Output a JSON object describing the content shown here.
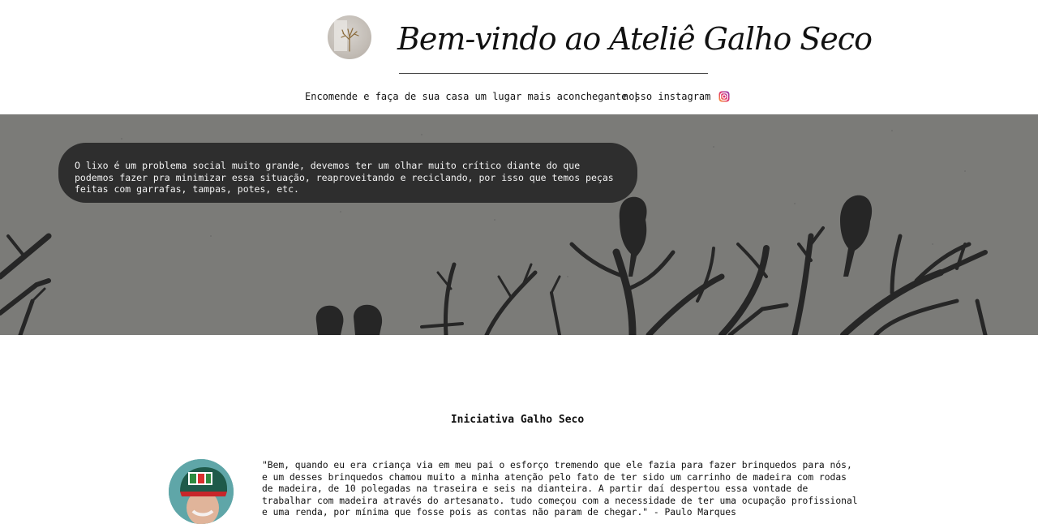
{
  "header": {
    "logo_icon": "branch-logo-icon",
    "title": "Bem-vindo ao Ateliê Galho Seco",
    "tagline": "Encomende e faça de sua casa um lugar mais aconchegante |",
    "instagram_link": "nosso instagram",
    "instagram_icon": "instagram-icon"
  },
  "hero": {
    "bubble_text": "O lixo é um problema social muito grande, devemos ter um olhar muito crítico diante do que podemos fazer pra minimizar essa situação, reaproveitando e reciclando, por isso que temos peças feitas com garrafas, tampas, potes, etc.",
    "background_color": "#7b7b78"
  },
  "initiative": {
    "title": "Iniciativa Galho Seco",
    "quote": "\"Bem, quando eu era criança via em meu pai o esforço tremendo que ele fazia para fazer brinquedos para nós, e um desses brinquedos chamou muito a minha atenção pelo fato de ter sido um carrinho de madeira com rodas de madeira, de 10 polegadas na traseira e seis na dianteira. A partir daí despertou essa vontade de trabalhar com madeira através do artesanato. tudo começou com a necessidade de ter uma ocupação profissional e uma renda, por mínima que fosse pois as contas não param de chegar.\" - Paulo Marques"
  }
}
